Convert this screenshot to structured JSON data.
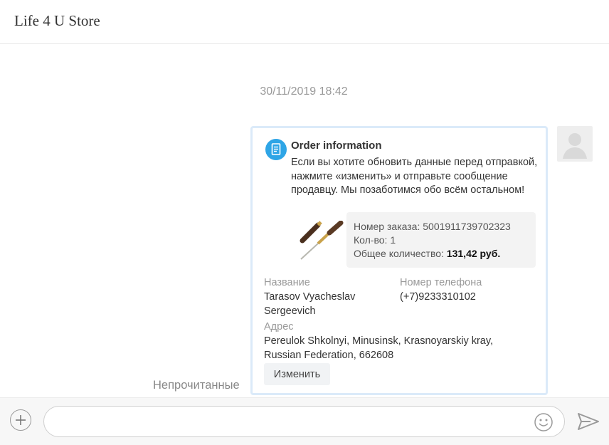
{
  "header": {
    "store_name": "Life 4 U Store"
  },
  "chat": {
    "timestamp": "30/11/2019 18:42",
    "unread_label": "Непрочитанные"
  },
  "order_card": {
    "title": "Order information",
    "message": "Если вы хотите обновить данные перед отправкой, нажмите «изменить» и отправьте сообщение продавцу. Мы позаботимся обо всём остальном!",
    "order_number_label": "Номер заказа:",
    "order_number": "5001911739702323",
    "quantity_label": "Кол-во:",
    "quantity": "1",
    "total_label": "Общее количество:",
    "total": "131,42 руб.",
    "name_label": "Название",
    "name_line1": "Tarasov Vyacheslav",
    "name_line2": "Sergeevich",
    "phone_label": "Номер телефона",
    "phone": "(+7)9233310102",
    "address_label": "Адрес",
    "address_line1": "Pereulok Shkolnyi, Minusinsk, Krasnoyarskiy kray,",
    "address_line2": "Russian Federation, 662608",
    "edit_button": "Изменить"
  },
  "composer": {
    "placeholder": ""
  },
  "icons": {
    "order": "document-icon",
    "avatar": "user-avatar-icon",
    "add": "plus-icon",
    "emoji": "smiley-icon",
    "send": "send-arrow-icon"
  },
  "colors": {
    "accent": "#2ea5e6",
    "card_border": "#dbeaf9"
  }
}
